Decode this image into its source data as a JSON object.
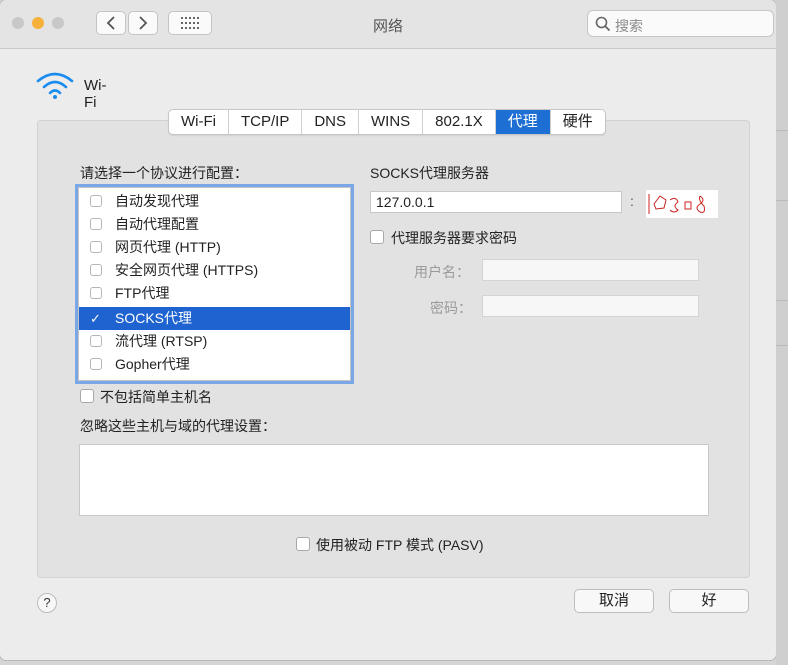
{
  "window": {
    "title": "网络"
  },
  "search": {
    "placeholder": "搜索"
  },
  "interface": {
    "name": "Wi-Fi"
  },
  "tabs": [
    {
      "label": "Wi-Fi"
    },
    {
      "label": "TCP/IP"
    },
    {
      "label": "DNS"
    },
    {
      "label": "WINS"
    },
    {
      "label": "802.1X"
    },
    {
      "label": "代理",
      "active": true
    },
    {
      "label": "硬件"
    }
  ],
  "protocols": {
    "heading": "请选择一个协议进行配置：",
    "items": [
      {
        "label": "自动发现代理",
        "checked": false
      },
      {
        "label": "自动代理配置",
        "checked": false
      },
      {
        "label": "网页代理 (HTTP)",
        "checked": false
      },
      {
        "label": "安全网页代理 (HTTPS)",
        "checked": false
      },
      {
        "label": "FTP代理",
        "checked": false
      },
      {
        "label": "SOCKS代理",
        "checked": true,
        "selected": true
      },
      {
        "label": "流代理 (RTSP)",
        "checked": false
      },
      {
        "label": "Gopher代理",
        "checked": false
      }
    ]
  },
  "exclude_simple": {
    "label": "不包括简单主机名",
    "checked": false
  },
  "bypass": {
    "label": "忽略这些主机与域的代理设置：",
    "value": ""
  },
  "socks": {
    "heading": "SOCKS代理服务器",
    "server": "127.0.0.1",
    "port_separator": ":",
    "requires_password": {
      "label": "代理服务器要求密码",
      "checked": false
    },
    "username_label": "用户名：",
    "password_label": "密码："
  },
  "pasv": {
    "label": "使用被动 FTP 模式 (PASV)",
    "checked": false
  },
  "buttons": {
    "cancel": "取消",
    "ok": "好"
  },
  "help": {
    "label": "?"
  },
  "colors": {
    "accent": "#1e63d0",
    "close": "#c5c5c5",
    "minimize": "#f6b13a"
  }
}
